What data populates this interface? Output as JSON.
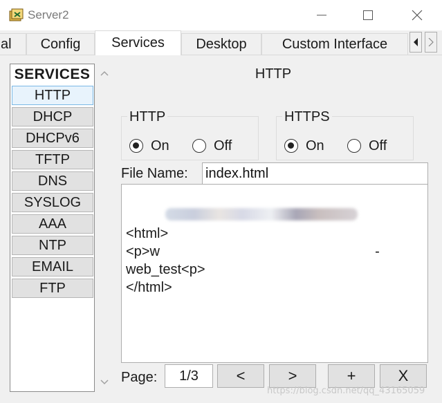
{
  "window": {
    "title": "Server2"
  },
  "tabs": [
    {
      "label": "al"
    },
    {
      "label": "Config"
    },
    {
      "label": "Services",
      "active": true
    },
    {
      "label": "Desktop"
    },
    {
      "label": "Custom Interface"
    }
  ],
  "services": {
    "heading": "SERVICES",
    "items": [
      {
        "label": "HTTP",
        "selected": true
      },
      {
        "label": "DHCP"
      },
      {
        "label": "DHCPv6"
      },
      {
        "label": "TFTP"
      },
      {
        "label": "DNS"
      },
      {
        "label": "SYSLOG"
      },
      {
        "label": "AAA"
      },
      {
        "label": "NTP"
      },
      {
        "label": "EMAIL"
      },
      {
        "label": "FTP"
      }
    ]
  },
  "http_panel": {
    "title": "HTTP",
    "http_group": {
      "legend": "HTTP",
      "on_label": "On",
      "off_label": "Off",
      "selected": "On"
    },
    "https_group": {
      "legend": "HTTPS",
      "on_label": "On",
      "off_label": "Off",
      "selected": "On"
    },
    "file_name_label": "File Name:",
    "file_name_value": "index.html",
    "file_content": "<html>\n<p>w                                                        -\nweb_test<p>\n</html>",
    "page_label": "Page:",
    "page_value": "1/3",
    "buttons": {
      "prev": "<",
      "next": ">",
      "add": "+",
      "remove": "X"
    }
  },
  "icons": {
    "app": "router-app-icon",
    "minimize": "minimize-icon",
    "maximize": "maximize-icon",
    "close": "close-icon",
    "tab_scroll": "chevron-left-icon"
  },
  "watermark": "https://blog.csdn.net/qq_43165059"
}
